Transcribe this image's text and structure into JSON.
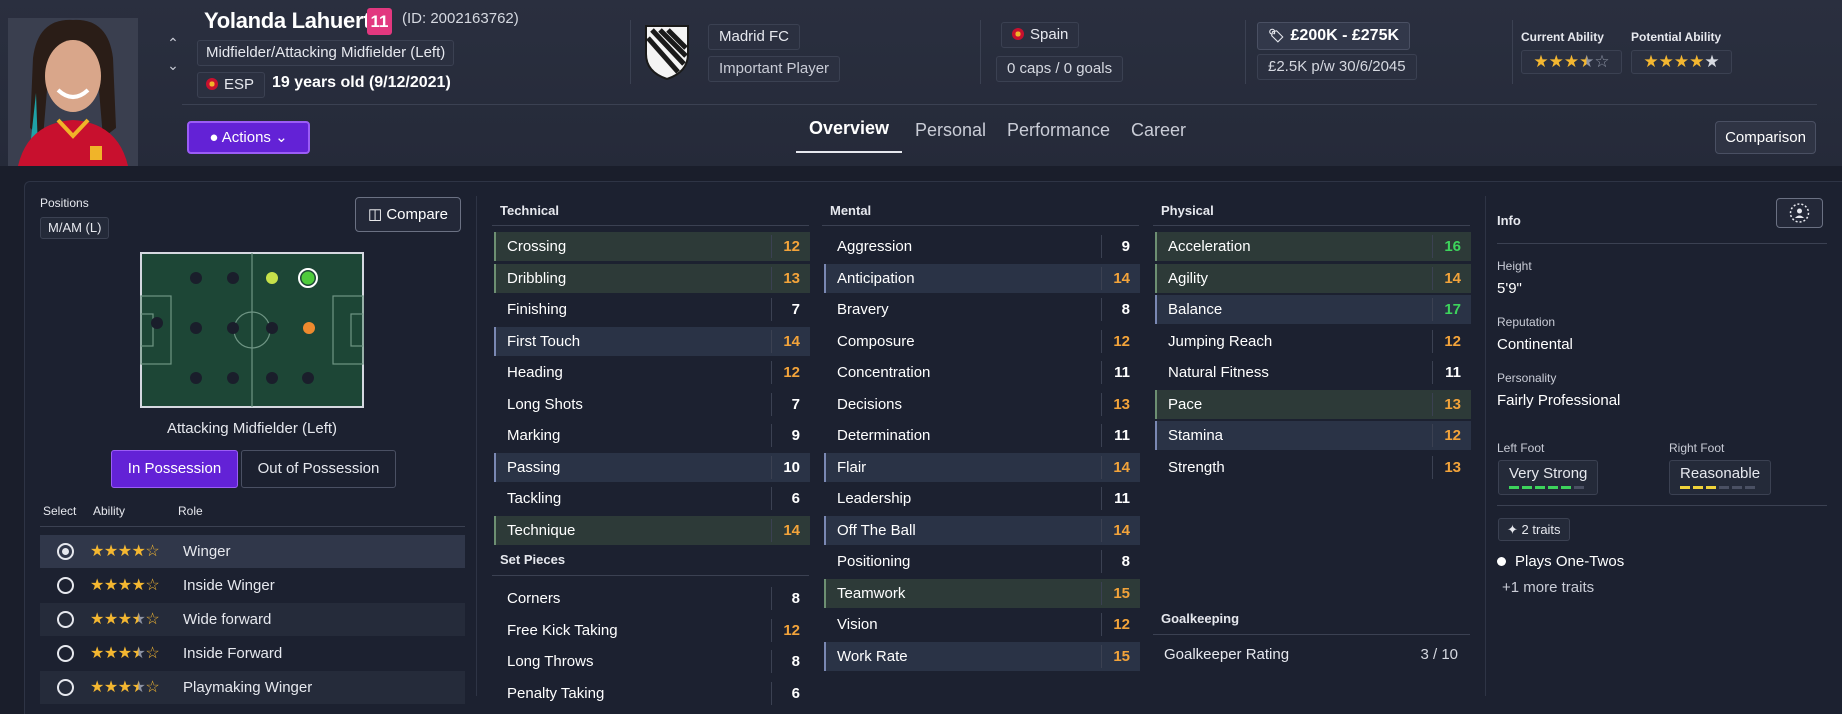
{
  "player": {
    "name": "Yolanda Lahuerta",
    "shirt_number": "11",
    "id_text": "(ID: 2002163762)",
    "position_text": "Midfielder/Attacking Midfielder (Left)",
    "nationality_code": "ESP",
    "age_text": "19 years old (9/12/2021)"
  },
  "club": {
    "name": "Madrid FC",
    "status": "Important Player"
  },
  "international": {
    "country": "Spain",
    "caps_text": "0 caps / 0 goals"
  },
  "contract": {
    "value_range": "£200K - £275K",
    "wage_text": "£2.5K p/w",
    "expires": "30/6/2045"
  },
  "ability": {
    "current_label": "Current Ability",
    "current_stars": 3.5,
    "potential_label": "Potential Ability",
    "potential_stars": 4.5
  },
  "actions_label": "Actions",
  "tabs": [
    {
      "label": "Overview",
      "active": true
    },
    {
      "label": "Personal",
      "active": false
    },
    {
      "label": "Performance",
      "active": false
    },
    {
      "label": "Career",
      "active": false
    }
  ],
  "comparison_label": "Comparison",
  "positions": {
    "label": "Positions",
    "tag": "M/AM (L)",
    "compare_label": "Compare",
    "pitch_caption": "Attacking Midfielder (Left)",
    "in_possession_label": "In Possession",
    "out_possession_label": "Out of Possession",
    "headers": {
      "select": "Select",
      "ability": "Ability",
      "role": "Role"
    },
    "roles": [
      {
        "name": "Winger",
        "stars": 4,
        "selected": true
      },
      {
        "name": "Inside Winger",
        "stars": 4,
        "selected": false
      },
      {
        "name": "Wide forward",
        "stars": 3.5,
        "selected": false
      },
      {
        "name": "Inside Forward",
        "stars": 3.5,
        "selected": false
      },
      {
        "name": "Playmaking Winger",
        "stars": 3.5,
        "selected": false
      }
    ]
  },
  "technical": {
    "title": "Technical",
    "items": [
      {
        "name": "Crossing",
        "value": "12",
        "hl": "g"
      },
      {
        "name": "Dribbling",
        "value": "13",
        "hl": "g"
      },
      {
        "name": "Finishing",
        "value": "7",
        "hl": ""
      },
      {
        "name": "First Touch",
        "value": "14",
        "hl": "b"
      },
      {
        "name": "Heading",
        "value": "12",
        "hl": ""
      },
      {
        "name": "Long Shots",
        "value": "7",
        "hl": ""
      },
      {
        "name": "Marking",
        "value": "9",
        "hl": ""
      },
      {
        "name": "Passing",
        "value": "10",
        "hl": "b"
      },
      {
        "name": "Tackling",
        "value": "6",
        "hl": ""
      },
      {
        "name": "Technique",
        "value": "14",
        "hl": "g"
      }
    ]
  },
  "set_pieces": {
    "title": "Set Pieces",
    "items": [
      {
        "name": "Corners",
        "value": "8",
        "hl": ""
      },
      {
        "name": "Free Kick Taking",
        "value": "12",
        "hl": ""
      },
      {
        "name": "Long Throws",
        "value": "8",
        "hl": ""
      },
      {
        "name": "Penalty Taking",
        "value": "6",
        "hl": ""
      }
    ]
  },
  "mental": {
    "title": "Mental",
    "items": [
      {
        "name": "Aggression",
        "value": "9",
        "hl": ""
      },
      {
        "name": "Anticipation",
        "value": "14",
        "hl": "b"
      },
      {
        "name": "Bravery",
        "value": "8",
        "hl": ""
      },
      {
        "name": "Composure",
        "value": "12",
        "hl": ""
      },
      {
        "name": "Concentration",
        "value": "11",
        "hl": ""
      },
      {
        "name": "Decisions",
        "value": "13",
        "hl": ""
      },
      {
        "name": "Determination",
        "value": "11",
        "hl": ""
      },
      {
        "name": "Flair",
        "value": "14",
        "hl": "b"
      },
      {
        "name": "Leadership",
        "value": "11",
        "hl": ""
      },
      {
        "name": "Off The Ball",
        "value": "14",
        "hl": "b"
      },
      {
        "name": "Positioning",
        "value": "8",
        "hl": ""
      },
      {
        "name": "Teamwork",
        "value": "15",
        "hl": "g"
      },
      {
        "name": "Vision",
        "value": "12",
        "hl": ""
      },
      {
        "name": "Work Rate",
        "value": "15",
        "hl": "b"
      }
    ]
  },
  "physical": {
    "title": "Physical",
    "items": [
      {
        "name": "Acceleration",
        "value": "16",
        "hl": "g"
      },
      {
        "name": "Agility",
        "value": "14",
        "hl": "g"
      },
      {
        "name": "Balance",
        "value": "17",
        "hl": "b"
      },
      {
        "name": "Jumping Reach",
        "value": "12",
        "hl": ""
      },
      {
        "name": "Natural Fitness",
        "value": "11",
        "hl": ""
      },
      {
        "name": "Pace",
        "value": "13",
        "hl": "g"
      },
      {
        "name": "Stamina",
        "value": "12",
        "hl": "b"
      },
      {
        "name": "Strength",
        "value": "13",
        "hl": ""
      }
    ]
  },
  "goalkeeping": {
    "title": "Goalkeeping",
    "rating_label": "Goalkeeper Rating",
    "rating_value": "3 / 10"
  },
  "info": {
    "title": "Info",
    "height_label": "Height",
    "height": "5'9\"",
    "reputation_label": "Reputation",
    "reputation": "Continental",
    "personality_label": "Personality",
    "personality": "Fairly Professional",
    "left_foot_label": "Left Foot",
    "left_foot": "Very Strong",
    "left_foot_level": 5,
    "right_foot_label": "Right Foot",
    "right_foot": "Reasonable",
    "right_foot_level": 3,
    "traits_count": "2 traits",
    "trait": "Plays One-Twos",
    "more_traits": "+1 more traits"
  },
  "colors": {
    "accent": "#6322d6",
    "star": "#f4b731",
    "value_orange": "#f2a33a",
    "value_green": "#3dd45c",
    "foot_green": "#3dd45c",
    "foot_yellow": "#f0d33a"
  }
}
